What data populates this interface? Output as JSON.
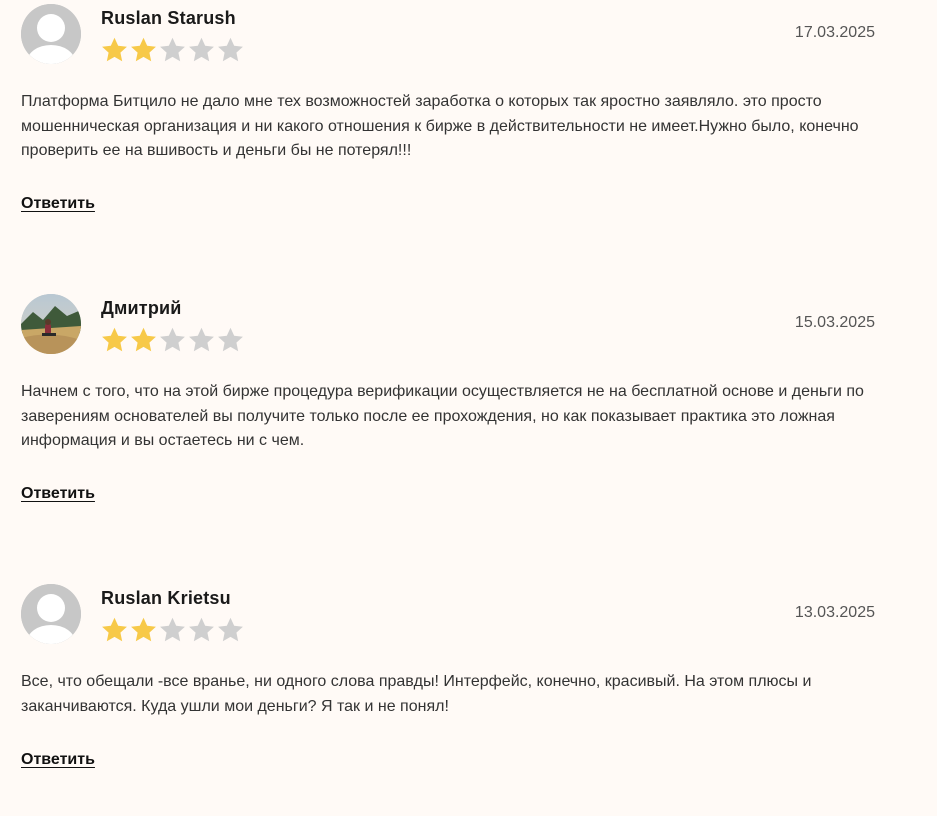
{
  "reviews": [
    {
      "author": "Ruslan Starush",
      "date": "17.03.2025",
      "rating": 2,
      "max_rating": 5,
      "avatar": "default-user-icon",
      "text": "Платформа Битцило не дало мне тех возможностей заработка о которых так яростно заявляло. это просто мошенническая организация и ни какого отношения к бирже в действительности не имеет.Нужно было, конечно проверить ее на вшивость и деньги бы не потерял!!!",
      "reply_label": "Ответить"
    },
    {
      "author": "Дмитрий",
      "date": "15.03.2025",
      "rating": 2,
      "max_rating": 5,
      "avatar": "photo-avatar",
      "text": "Начнем с того, что на этой бирже процедура верификации осуществляется не на бесплатной основе и деньги по заверениям основателей вы получите только после ее прохождения, но как показывает практика это ложная информация и вы остаетесь ни с чем.",
      "reply_label": "Ответить"
    },
    {
      "author": "Ruslan Krietsu",
      "date": "13.03.2025",
      "rating": 2,
      "max_rating": 5,
      "avatar": "default-user-icon",
      "text": "Все, что обещали -все вранье, ни одного слова правды! Интерфейс, конечно, красивый. На этом плюсы и заканчиваются. Куда ушли мои деньги? Я так и не понял!",
      "reply_label": "Ответить"
    }
  ],
  "colors": {
    "star_filled": "#f7c948",
    "star_empty": "#cfcfcf",
    "avatar_default": "#c7c7c7"
  }
}
